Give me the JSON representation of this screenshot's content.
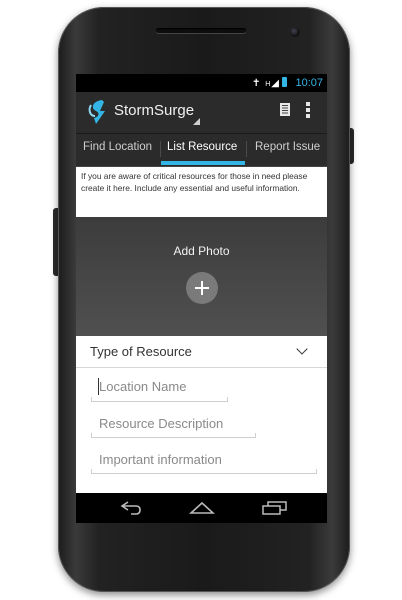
{
  "statusbar": {
    "time": "10:07"
  },
  "actionbar": {
    "title": "StormSurge"
  },
  "tabs": [
    {
      "label": "Find Location"
    },
    {
      "label": "List Resource"
    },
    {
      "label": "Report Issue"
    }
  ],
  "info_text": "If you are aware of critical resources for those in need please create it here. Include any essential and useful information.",
  "photo": {
    "label": "Add Photo"
  },
  "form": {
    "type_label": "Type of Resource",
    "location_placeholder": "Location Name",
    "description_placeholder": "Resource Description",
    "important_placeholder": "Important information"
  },
  "colors": {
    "accent": "#33b5e5",
    "actionbar": "#2b2b2b"
  },
  "icons": [
    "back-icon",
    "home-icon",
    "recents-icon",
    "menu-overflow-icon",
    "document-icon"
  ]
}
